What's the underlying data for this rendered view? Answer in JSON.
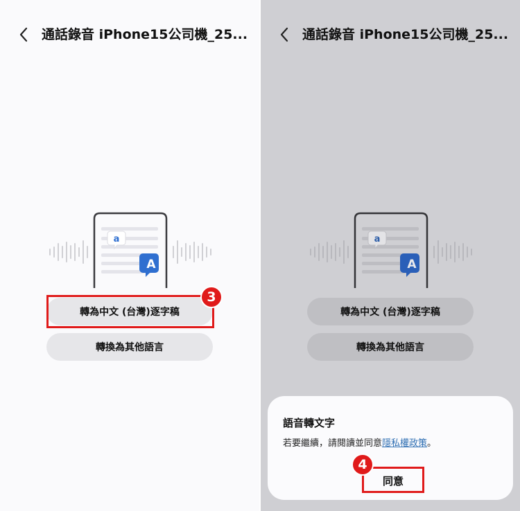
{
  "screens": [
    {
      "title": "通話錄音 iPhone15公司機_25...",
      "buttons": {
        "transcribe": "轉為中文 (台灣)逐字稿",
        "other_lang": "轉換為其他語言"
      },
      "step": "3",
      "illustration": {
        "small_letter": "a",
        "big_letter": "A"
      }
    },
    {
      "title": "通話錄音 iPhone15公司機_25...",
      "buttons": {
        "transcribe": "轉為中文 (台灣)逐字稿",
        "other_lang": "轉換為其他語言"
      },
      "illustration": {
        "small_letter": "a",
        "big_letter": "A"
      },
      "dialog": {
        "title": "語音轉文字",
        "body_prefix": "若要繼續，請閱讀並同意",
        "link": "隱私權政策",
        "body_suffix": "。",
        "agree": "同意"
      },
      "step": "4"
    }
  ],
  "colors": {
    "highlight": "#e01a1a",
    "link": "#2f6fb3",
    "accent_blue": "#2f6fd0"
  },
  "icons": [
    "chevron-left-icon",
    "phone-transcript-illustration",
    "letter-a-bubble-icon",
    "sound-wave-icon"
  ]
}
